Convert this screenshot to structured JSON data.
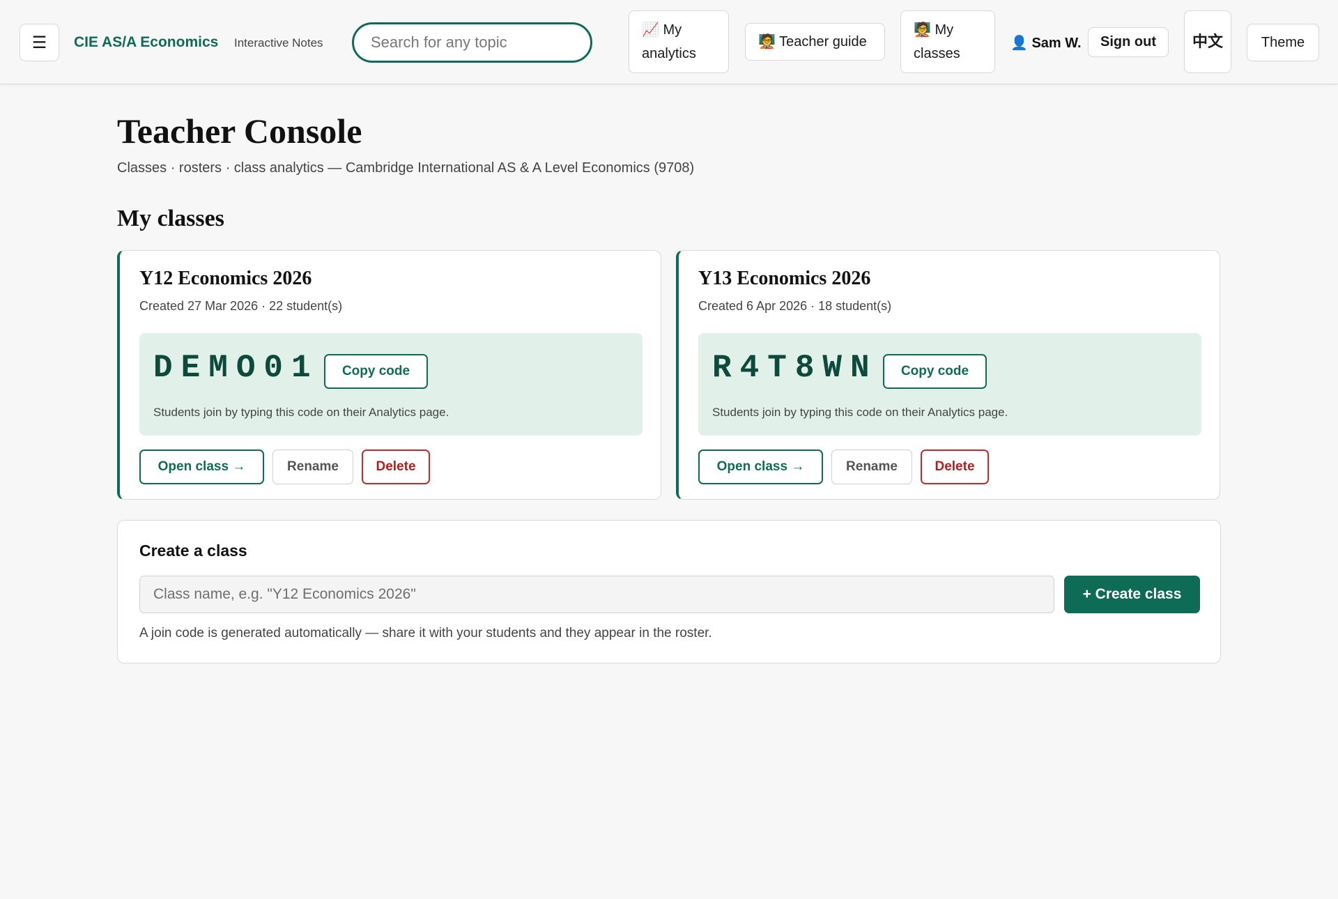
{
  "header": {
    "menu_icon": "☰",
    "brand": "CIE AS/A Economics",
    "brand_sub": "Interactive Notes",
    "search_placeholder": "Search for any topic",
    "nav": {
      "analytics": "📈 My analytics",
      "teacher_guide": "🧑‍🏫 Teacher guide",
      "classes": "🧑‍🏫 My classes"
    },
    "user": "👤 Sam W.",
    "sign_out": "Sign out",
    "language": "中文",
    "theme": "Theme"
  },
  "page": {
    "title": "Teacher Console",
    "subtitle": "Classes · rosters · class analytics — Cambridge International AS & A Level Economics (9708)",
    "section_title": "My classes"
  },
  "classes": [
    {
      "name": "Y12 Economics 2026",
      "meta": "Created 27 Mar 2026 · 22 student(s)",
      "code": "DEMO01",
      "copy_label": "Copy code",
      "hint": "Students join by typing this code on their Analytics page.",
      "open_label": "Open class →",
      "rename_label": "Rename",
      "delete_label": "Delete"
    },
    {
      "name": "Y13 Economics 2026",
      "meta": "Created 6 Apr 2026 · 18 student(s)",
      "code": "R4T8WN",
      "copy_label": "Copy code",
      "hint": "Students join by typing this code on their Analytics page.",
      "open_label": "Open class →",
      "rename_label": "Rename",
      "delete_label": "Delete"
    }
  ],
  "create": {
    "title": "Create a class",
    "placeholder": "Class name, e.g. \"Y12 Economics 2026\"",
    "button": "+ Create class",
    "hint": "A join code is generated automatically — share it with your students and they appear in the roster."
  },
  "colors": {
    "accent": "#0e6b55",
    "code_bg": "#e2f0ea",
    "danger": "#b71c1c"
  }
}
